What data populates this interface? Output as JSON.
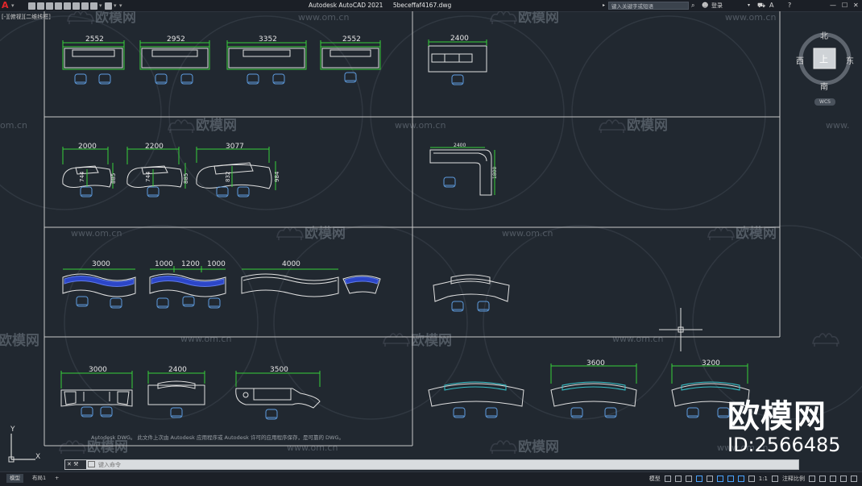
{
  "app": {
    "title": "Autodesk AutoCAD 2021",
    "filename": "5beceffaf4167.dwg",
    "search_placeholder": "键入关键字或短语",
    "login_label": "登录",
    "help_label": "?"
  },
  "viewport": {
    "label": "[-][俯视][二维线框]"
  },
  "compass": {
    "north": "北",
    "south": "南",
    "east": "东",
    "west": "西",
    "top": "上",
    "wcs": "WCS"
  },
  "ucs": {
    "x": "X",
    "y": "Y"
  },
  "watermark": {
    "logo_text": "欧模网",
    "url_text": "www.om.cn",
    "brand": "欧模网",
    "id": "ID:2566485"
  },
  "command": {
    "placeholder": "键入命令",
    "history": "Autodesk DWG。 此文件上次由 Autodesk 应用程序或 Autodesk 许可的应用程序保存，是可靠的 DWG。",
    "close_label": "✕"
  },
  "layout_tabs": [
    {
      "label": "模型",
      "active": true
    },
    {
      "label": "布局1",
      "active": false
    },
    {
      "label": "+",
      "active": false
    }
  ],
  "statusbar": {
    "model": "模型",
    "scale": "1:1",
    "annotate": "注释比例"
  },
  "dimensions": {
    "row1": [
      "2552",
      "2952",
      "3352",
      "2552"
    ],
    "row1_right": "2400",
    "row2": [
      "2000",
      "2200",
      "3077"
    ],
    "row2_depths": [
      "744",
      "744",
      "832"
    ],
    "row2_heights": [
      "885",
      "885",
      "984"
    ],
    "row2_right_w": "2400",
    "row2_right_h": "1800",
    "row3": [
      "3000",
      "1000",
      "1200",
      "1000",
      "4000"
    ],
    "row4": [
      "3000",
      "2400",
      "3500"
    ],
    "row4_right": [
      "3600",
      "3200"
    ]
  },
  "colors": {
    "background": "#212830",
    "dimension": "#38d13a",
    "linework": "#e0e0e0",
    "chair": "#5e9de0",
    "accent_blue": "#2c46c8",
    "accent_cyan": "#37c0c8"
  }
}
